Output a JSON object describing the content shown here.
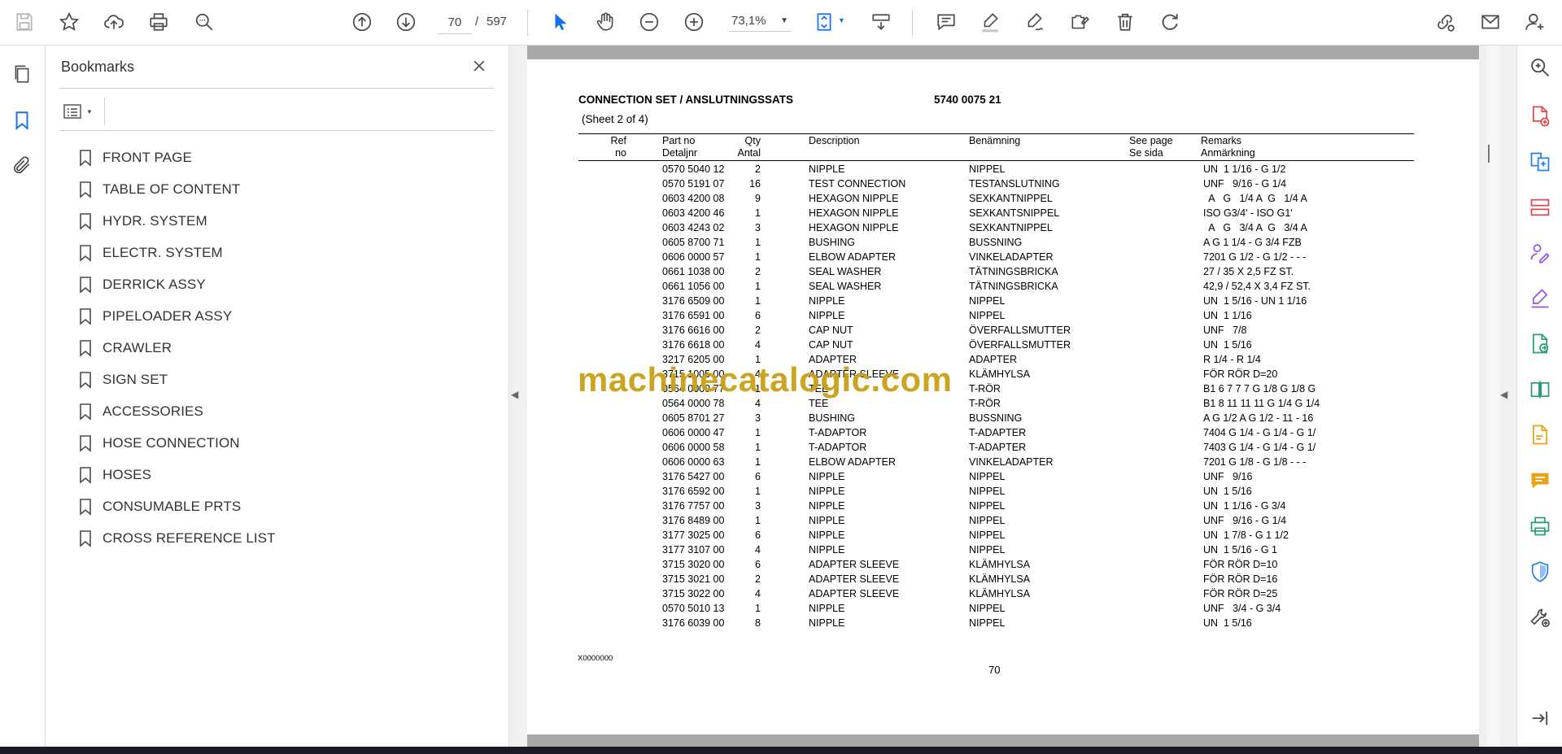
{
  "toolbar": {
    "page_current": "70",
    "page_separator": "/",
    "page_total": "597",
    "zoom": "73,1%"
  },
  "bookmarks": {
    "title": "Bookmarks",
    "items": [
      {
        "label": "FRONT PAGE"
      },
      {
        "label": "TABLE OF CONTENT"
      },
      {
        "label": "HYDR. SYSTEM"
      },
      {
        "label": "ELECTR. SYSTEM"
      },
      {
        "label": "DERRICK ASSY"
      },
      {
        "label": "PIPELOADER ASSY"
      },
      {
        "label": "CRAWLER"
      },
      {
        "label": "SIGN SET"
      },
      {
        "label": "ACCESSORIES"
      },
      {
        "label": "HOSE CONNECTION"
      },
      {
        "label": "HOSES"
      },
      {
        "label": "CONSUMABLE PRTS"
      },
      {
        "label": "CROSS REFERENCE LIST"
      }
    ]
  },
  "document": {
    "title": "CONNECTION SET / ANSLUTNINGSSATS",
    "number": "5740 0075 21",
    "sheet": "(Sheet 2 of 4)",
    "headers": {
      "ref_1": "Ref",
      "ref_2": "no",
      "part_1": "Part no",
      "part_2": "Detaljnr",
      "qty_1": "Qty",
      "qty_2": "Antal",
      "desc": "Description",
      "ben": "Benämning",
      "see_1": "See page",
      "see_2": "Se sida",
      "rem_1": "Remarks",
      "rem_2": "Anmärkning"
    },
    "rows": [
      {
        "part": "0570 5040 12",
        "qty": "2",
        "desc": "NIPPLE",
        "ben": "NIPPEL",
        "rem": "UN  1 1/16 - G 1/2"
      },
      {
        "part": "0570 5191 07",
        "qty": "16",
        "desc": "TEST CONNECTION",
        "ben": "TESTANSLUTNING",
        "rem": "UNF   9/16 - G 1/4"
      },
      {
        "part": "0603 4200 08",
        "qty": "9",
        "desc": "HEXAGON NIPPLE",
        "ben": "SEXKANTNIPPEL",
        "rem": "  A   G   1/4 A  G   1/4 A"
      },
      {
        "part": "0603 4200 46",
        "qty": "1",
        "desc": "HEXAGON NIPPLE",
        "ben": "SEXKANTSNIPPEL",
        "rem": "ISO G3/4' - ISO G1'"
      },
      {
        "part": "0603 4243 02",
        "qty": "3",
        "desc": "HEXAGON NIPPLE",
        "ben": "SEXKANTNIPPEL",
        "rem": "  A   G   3/4 A  G   3/4 A"
      },
      {
        "part": "0605 8700 71",
        "qty": "1",
        "desc": "BUSHING",
        "ben": "BUSSNING",
        "rem": "A G 1 1/4 - G 3/4 FZB"
      },
      {
        "part": "0606 0000 57",
        "qty": "1",
        "desc": "ELBOW ADAPTER",
        "ben": "VINKELADAPTER",
        "rem": "7201 G 1/2 - G 1/2 - - -"
      },
      {
        "part": "0661 1038 00",
        "qty": "2",
        "desc": "SEAL WASHER",
        "ben": "TÄTNINGSBRICKA",
        "rem": "27 / 35 X 2,5 FZ ST."
      },
      {
        "part": "0661 1056 00",
        "qty": "1",
        "desc": "SEAL WASHER",
        "ben": "TÄTNINGSBRICKA",
        "rem": "42,9 / 52,4 X 3,4 FZ ST."
      },
      {
        "part": "3176 6509 00",
        "qty": "1",
        "desc": "NIPPLE",
        "ben": "NIPPEL",
        "rem": "UN  1 5/16 - UN 1 1/16"
      },
      {
        "part": "3176 6591 00",
        "qty": "6",
        "desc": "NIPPLE",
        "ben": "NIPPEL",
        "rem": "UN  1 1/16"
      },
      {
        "part": "3176 6616 00",
        "qty": "2",
        "desc": "CAP NUT",
        "ben": "ÖVERFALLSMUTTER",
        "rem": "UNF   7/8"
      },
      {
        "part": "3176 6618 00",
        "qty": "4",
        "desc": "CAP NUT",
        "ben": "ÖVERFALLSMUTTER",
        "rem": "UN  1 5/16"
      },
      {
        "part": "3217 6205 00",
        "qty": "1",
        "desc": "ADAPTER",
        "ben": "ADAPTER",
        "rem": "R 1/4 - R 1/4"
      },
      {
        "part": "3715 1005 00",
        "qty": "4",
        "desc": "ADAPTER SLEEVE",
        "ben": "KLÄMHYLSA",
        "rem": "FÖR RÖR D=20"
      },
      {
        "part": "0564 0000 77",
        "qty": "1",
        "desc": "TEE",
        "ben": "T-RÖR",
        "rem": "B1 6 7 7 7 G 1/8 G 1/8 G"
      },
      {
        "part": "0564 0000 78",
        "qty": "4",
        "desc": "TEE",
        "ben": "T-RÖR",
        "rem": "B1 8 11 11 11 G 1/4 G 1/4"
      },
      {
        "part": "0605 8701 27",
        "qty": "3",
        "desc": "BUSHING",
        "ben": "BUSSNING",
        "rem": "A G 1/2 A G 1/2 - 11 - 16"
      },
      {
        "part": "0606 0000 47",
        "qty": "1",
        "desc": "T-ADAPTOR",
        "ben": "T-ADAPTER",
        "rem": "7404 G 1/4 - G 1/4 - G 1/"
      },
      {
        "part": "0606 0000 58",
        "qty": "1",
        "desc": "T-ADAPTOR",
        "ben": "T-ADAPTER",
        "rem": "7403 G 1/4 - G 1/4 - G 1/"
      },
      {
        "part": "0606 0000 63",
        "qty": "1",
        "desc": "ELBOW ADAPTER",
        "ben": "VINKELADAPTER",
        "rem": "7201 G 1/8 - G 1/8 - - -"
      },
      {
        "part": "3176 5427 00",
        "qty": "6",
        "desc": "NIPPLE",
        "ben": "NIPPEL",
        "rem": "UNF   9/16"
      },
      {
        "part": "3176 6592 00",
        "qty": "1",
        "desc": "NIPPLE",
        "ben": "NIPPEL",
        "rem": "UN  1 5/16"
      },
      {
        "part": "3176 7757 00",
        "qty": "3",
        "desc": "NIPPLE",
        "ben": "NIPPEL",
        "rem": "UN  1 1/16 - G 3/4"
      },
      {
        "part": "3176 8489 00",
        "qty": "1",
        "desc": "NIPPLE",
        "ben": "NIPPEL",
        "rem": "UNF   9/16 - G 1/4"
      },
      {
        "part": "3177 3025 00",
        "qty": "6",
        "desc": "NIPPLE",
        "ben": "NIPPEL",
        "rem": "UN  1 7/8 - G 1 1/2"
      },
      {
        "part": "3177 3107 00",
        "qty": "4",
        "desc": "NIPPLE",
        "ben": "NIPPEL",
        "rem": "UN  1 5/16 - G 1"
      },
      {
        "part": "3715 3020 00",
        "qty": "6",
        "desc": "ADAPTER SLEEVE",
        "ben": "KLÄMHYLSA",
        "rem": "FÖR RÖR D=10"
      },
      {
        "part": "3715 3021 00",
        "qty": "2",
        "desc": "ADAPTER SLEEVE",
        "ben": "KLÄMHYLSA",
        "rem": "FÖR RÖR D=16"
      },
      {
        "part": "3715 3022 00",
        "qty": "4",
        "desc": "ADAPTER SLEEVE",
        "ben": "KLÄMHYLSA",
        "rem": "FÖR RÖR D=25"
      },
      {
        "part": "0570 5010 13",
        "qty": "1",
        "desc": "NIPPLE",
        "ben": "NIPPEL",
        "rem": "UNF   3/4 - G 3/4"
      },
      {
        "part": "3176 6039 00",
        "qty": "8",
        "desc": "NIPPLE",
        "ben": "NIPPEL",
        "rem": "UN  1 5/16"
      }
    ],
    "code": "X0000000",
    "page_number": "70",
    "watermark": "machinecatalogic.com"
  },
  "colors": {
    "accent_blue": "#1473e6",
    "icon_gray": "#4b4b4b",
    "watermark": "#c9a117",
    "red_tool": "#e34850",
    "purple_tool": "#9256d9",
    "blue_tool": "#2680eb",
    "yellow_tool": "#e8a317",
    "green_tool": "#2d9d78"
  }
}
